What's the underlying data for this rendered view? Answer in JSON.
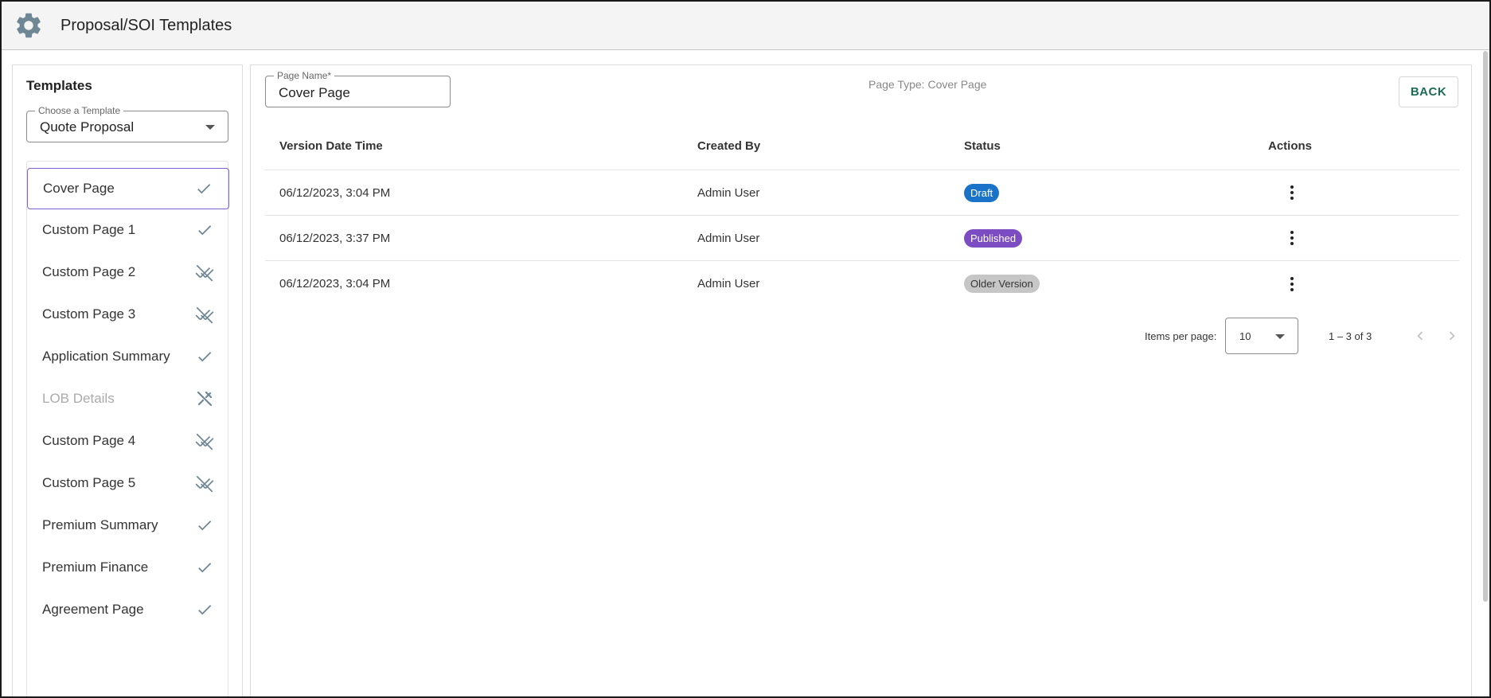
{
  "header": {
    "title": "Proposal/SOI Templates",
    "icon": "gear-icon",
    "icon_color": "#6f8795"
  },
  "sidebar": {
    "title": "Templates",
    "template_select": {
      "label": "Choose a Template",
      "value": "Quote Proposal"
    },
    "items": [
      {
        "label": "Cover Page",
        "status_icon": "check-icon",
        "selected": true,
        "disabled": false
      },
      {
        "label": "Custom Page 1",
        "status_icon": "check-icon",
        "selected": false,
        "disabled": false
      },
      {
        "label": "Custom Page 2",
        "status_icon": "remove-done-icon",
        "selected": false,
        "disabled": false
      },
      {
        "label": "Custom Page 3",
        "status_icon": "remove-done-icon",
        "selected": false,
        "disabled": false
      },
      {
        "label": "Application Summary",
        "status_icon": "check-icon",
        "selected": false,
        "disabled": false
      },
      {
        "label": "LOB Details",
        "status_icon": "edit-off-icon",
        "selected": false,
        "disabled": true
      },
      {
        "label": "Custom Page 4",
        "status_icon": "remove-done-icon",
        "selected": false,
        "disabled": false
      },
      {
        "label": "Custom Page 5",
        "status_icon": "remove-done-icon",
        "selected": false,
        "disabled": false
      },
      {
        "label": "Premium Summary",
        "status_icon": "check-icon",
        "selected": false,
        "disabled": false
      },
      {
        "label": "Premium Finance",
        "status_icon": "check-icon",
        "selected": false,
        "disabled": false
      },
      {
        "label": "Agreement Page",
        "status_icon": "check-icon",
        "selected": false,
        "disabled": false
      }
    ]
  },
  "main": {
    "page_name": {
      "label": "Page Name*",
      "value": "Cover Page"
    },
    "page_type": "Page Type: Cover Page",
    "back_label": "BACK",
    "table": {
      "columns": [
        "Version Date Time",
        "Created By",
        "Status",
        "Actions"
      ],
      "rows": [
        {
          "version": "06/12/2023, 3:04 PM",
          "created_by": "Admin User",
          "status": "Draft"
        },
        {
          "version": "06/12/2023, 3:37 PM",
          "created_by": "Admin User",
          "status": "Published"
        },
        {
          "version": "06/12/2023, 3:04 PM",
          "created_by": "Admin User",
          "status": "Older Version"
        }
      ]
    },
    "paginator": {
      "items_per_page_label": "Items per page:",
      "items_per_page": "10",
      "range": "1 – 3 of 3"
    }
  },
  "colors": {
    "draft": "#1b72c9",
    "published": "#7b4cc2",
    "older_version": "#c6c6c6",
    "selected_border": "#7e5fd4",
    "back_text": "#1d6b55",
    "status_icon": "#6f8795"
  }
}
